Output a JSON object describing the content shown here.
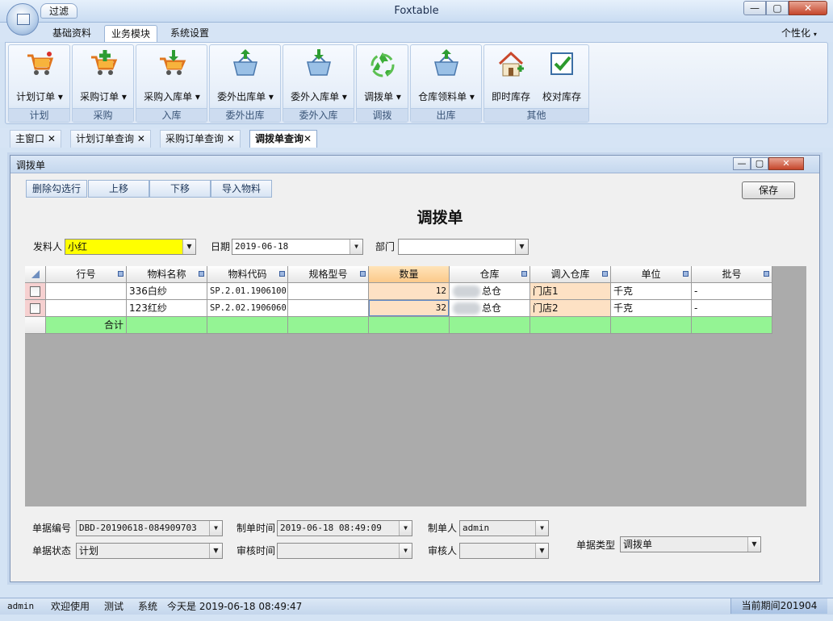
{
  "window": {
    "title": "Foxtable",
    "filter_tab": "过滤",
    "min": "—",
    "max": "▢",
    "close": "✕"
  },
  "ribbon_tabs": [
    "基础资料",
    "业务模块",
    "系统设置"
  ],
  "personalize": "个性化",
  "ribbon_groups": [
    {
      "label": "计划",
      "buttons": [
        "计划订单"
      ]
    },
    {
      "label": "采购",
      "buttons": [
        "采购订单"
      ]
    },
    {
      "label": "入库",
      "buttons": [
        "采购入库单"
      ]
    },
    {
      "label": "委外出库",
      "buttons": [
        "委外出库单"
      ]
    },
    {
      "label": "委外入库",
      "buttons": [
        "委外入库单"
      ]
    },
    {
      "label": "调拨",
      "buttons": [
        "调拨单"
      ]
    },
    {
      "label": "出库",
      "buttons": [
        "仓库领料单"
      ]
    },
    {
      "label": "其他",
      "buttons": [
        "即时库存",
        "校对库存"
      ]
    }
  ],
  "doc_tabs": [
    "主窗口",
    "计划订单查询",
    "采购订单查询",
    "调拨单查询"
  ],
  "inner_window": {
    "title": "调拨单"
  },
  "toolbar": {
    "delete_checked": "删除勾选行",
    "move_up": "上移",
    "move_down": "下移",
    "import": "导入物料",
    "save": "保存"
  },
  "form": {
    "title": "调拨单",
    "sender_label": "发料人",
    "sender_value": "小红",
    "date_label": "日期",
    "date_value": "2019-06-18",
    "dept_label": "部门",
    "dept_value": ""
  },
  "grid": {
    "columns": [
      "行号",
      "物料名称",
      "物料代码",
      "规格型号",
      "数量",
      "仓库",
      "调入仓库",
      "单位",
      "批号"
    ],
    "rows": [
      {
        "line": "",
        "name": "336白纱",
        "code": "SP.2.01.1906100",
        "spec": "",
        "qty": "12",
        "warehouse": "总仓",
        "to_warehouse": "门店1",
        "unit": "千克",
        "batch": "-"
      },
      {
        "line": "",
        "name": "123红纱",
        "code": "SP.2.02.1906060",
        "spec": "",
        "qty": "32",
        "warehouse": "总仓",
        "to_warehouse": "门店2",
        "unit": "千克",
        "batch": "-"
      }
    ],
    "total_label": "合计"
  },
  "footer": {
    "doc_no_label": "单据编号",
    "doc_no": "DBD-20190618-084909703",
    "created_time_label": "制单时间",
    "created_time": "2019-06-18 08:49:09",
    "creator_label": "制单人",
    "creator": "admin",
    "doc_type_label": "单据类型",
    "doc_type": "调拨单",
    "status_label": "单据状态",
    "status": "计划",
    "audit_time_label": "审核时间",
    "audit_time": "",
    "auditor_label": "审核人",
    "auditor": ""
  },
  "statusbar": {
    "user": "admin",
    "welcome": "欢迎使用",
    "test": "测试",
    "system": "系统",
    "today": "今天是 2019-06-18 08:49:47",
    "period": "当前期间201904"
  }
}
